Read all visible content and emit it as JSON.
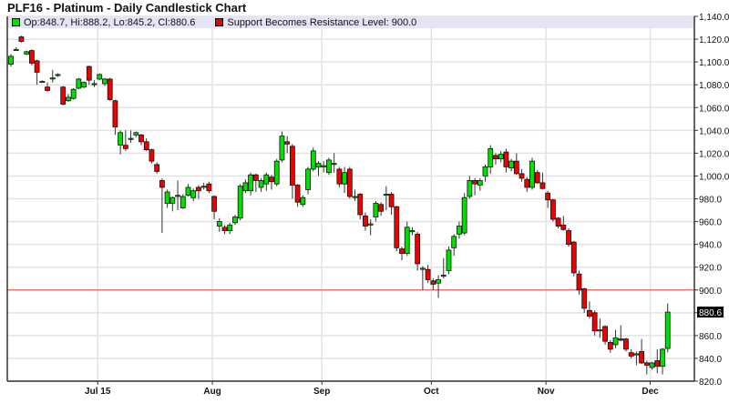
{
  "chart_data": {
    "type": "candlestick",
    "title": "PLF16 - Platinum - Daily Candlestick Chart",
    "legend": {
      "ohlc_label": "Op:848.7, Hi:888.2, Lo:845.2, Cl:880.6",
      "level_label": "Support Becomes Resistance Level: 900.0",
      "placement": "top-left"
    },
    "ylim": [
      820,
      1140
    ],
    "y_ticks": [
      "820.0",
      "840.0",
      "860.0",
      "880.0",
      "900.0",
      "920.0",
      "940.0",
      "960.0",
      "980.0",
      "1,000.0",
      "1,020.0",
      "1,040.0",
      "1,060.0",
      "1,080.0",
      "1,100.0",
      "1,120.0",
      "1,140.0"
    ],
    "y_tick_values": [
      820,
      840,
      860,
      880,
      900,
      920,
      940,
      960,
      980,
      1000,
      1020,
      1040,
      1060,
      1080,
      1100,
      1120,
      1140
    ],
    "x_ticks": [
      {
        "label": "Jul 15",
        "index": 17
      },
      {
        "label": "Aug",
        "index": 39
      },
      {
        "label": "Sep",
        "index": 60
      },
      {
        "label": "Oct",
        "index": 81
      },
      {
        "label": "Nov",
        "index": 103
      },
      {
        "label": "Dec",
        "index": 123
      }
    ],
    "last_price_label": "880.6",
    "last_price": 880.6,
    "resistance_level": 900.0,
    "grid": true,
    "colors": {
      "up": "#00e000",
      "down": "#ee0000",
      "level": "#f06060",
      "grid": "#e2e2e2"
    },
    "ohlc": [
      [
        1098,
        1107,
        1096,
        1105
      ],
      [
        1111,
        1113,
        1110,
        1111
      ],
      [
        1122,
        1123,
        1117,
        1118
      ],
      [
        1107,
        1110,
        1106,
        1109
      ],
      [
        1110,
        1111,
        1097,
        1099
      ],
      [
        1101,
        1102,
        1080,
        1091
      ],
      [
        1083,
        1084,
        1082,
        1083
      ],
      [
        1078,
        1082,
        1074,
        1075
      ],
      [
        1086,
        1093,
        1082,
        1086
      ],
      [
        1089,
        1090,
        1087,
        1089
      ],
      [
        1078,
        1079,
        1062,
        1063
      ],
      [
        1066,
        1072,
        1065,
        1069
      ],
      [
        1068,
        1077,
        1067,
        1076
      ],
      [
        1077,
        1086,
        1076,
        1085
      ],
      [
        1078,
        1083,
        1077,
        1082
      ],
      [
        1096,
        1097,
        1080,
        1084
      ],
      [
        1081,
        1084,
        1078,
        1081
      ],
      [
        1085,
        1090,
        1084,
        1089
      ],
      [
        1081,
        1086,
        1079,
        1085
      ],
      [
        1085,
        1086,
        1066,
        1067
      ],
      [
        1066,
        1067,
        1036,
        1043
      ],
      [
        1027,
        1040,
        1019,
        1038
      ],
      [
        1027,
        1040,
        1022,
        1024
      ],
      [
        1033,
        1040,
        1029,
        1033
      ],
      [
        1036,
        1039,
        1034,
        1038
      ],
      [
        1036,
        1037,
        1027,
        1030
      ],
      [
        1030,
        1033,
        1022,
        1023
      ],
      [
        1023,
        1024,
        1011,
        1013
      ],
      [
        1010,
        1012,
        1002,
        1004
      ],
      [
        996,
        998,
        950,
        990
      ],
      [
        976,
        988,
        972,
        986
      ],
      [
        976,
        982,
        969,
        981
      ],
      [
        983,
        996,
        970,
        983
      ],
      [
        972,
        984,
        971,
        982
      ],
      [
        983,
        993,
        982,
        990
      ],
      [
        981,
        989,
        978,
        987
      ],
      [
        990,
        992,
        980,
        987
      ],
      [
        991,
        994,
        988,
        991
      ],
      [
        993,
        995,
        985,
        987
      ],
      [
        982,
        983,
        962,
        969
      ],
      [
        956,
        963,
        951,
        960
      ],
      [
        955,
        957,
        949,
        952
      ],
      [
        952,
        959,
        949,
        957
      ],
      [
        959,
        966,
        957,
        964
      ],
      [
        963,
        993,
        961,
        991
      ],
      [
        987,
        997,
        985,
        994
      ],
      [
        987,
        1003,
        983,
        1001
      ],
      [
        1001,
        1002,
        986,
        996
      ],
      [
        990,
        998,
        986,
        996
      ],
      [
        993,
        1003,
        987,
        1001
      ],
      [
        999,
        1001,
        988,
        995
      ],
      [
        993,
        1015,
        991,
        1013
      ],
      [
        1014,
        1039,
        1012,
        1035
      ],
      [
        1030,
        1035,
        1020,
        1028
      ],
      [
        1026,
        1028,
        980,
        992
      ],
      [
        992,
        993,
        973,
        977
      ],
      [
        975,
        983,
        973,
        981
      ],
      [
        988,
        1008,
        984,
        1006
      ],
      [
        1006,
        1025,
        1004,
        1022
      ],
      [
        1008,
        1013,
        1000,
        1011
      ],
      [
        1009,
        1013,
        1003,
        1009
      ],
      [
        1003,
        1016,
        1001,
        1014
      ],
      [
        1011,
        1020,
        1003,
        1011
      ],
      [
        1006,
        1008,
        990,
        993
      ],
      [
        993,
        1008,
        985,
        1003
      ],
      [
        1006,
        1008,
        980,
        982
      ],
      [
        982,
        988,
        978,
        982
      ],
      [
        984,
        985,
        962,
        966
      ],
      [
        965,
        968,
        952,
        956
      ],
      [
        957,
        962,
        948,
        958
      ],
      [
        964,
        978,
        960,
        976
      ],
      [
        975,
        977,
        965,
        969
      ],
      [
        984,
        991,
        970,
        984
      ],
      [
        984,
        986,
        966,
        973
      ],
      [
        973,
        974,
        934,
        937
      ],
      [
        936,
        938,
        926,
        932
      ],
      [
        932,
        960,
        930,
        955
      ],
      [
        952,
        955,
        948,
        952
      ],
      [
        949,
        951,
        917,
        923
      ],
      [
        919,
        921,
        900,
        919
      ],
      [
        918,
        922,
        906,
        909
      ],
      [
        908,
        910,
        900,
        905
      ],
      [
        906,
        913,
        893,
        909
      ],
      [
        912,
        928,
        910,
        913
      ],
      [
        917,
        938,
        914,
        935
      ],
      [
        937,
        949,
        930,
        947
      ],
      [
        949,
        960,
        945,
        956
      ],
      [
        950,
        985,
        948,
        981
      ],
      [
        982,
        1000,
        980,
        996
      ],
      [
        996,
        998,
        983,
        993
      ],
      [
        992,
        998,
        987,
        996
      ],
      [
        1000,
        1010,
        995,
        1008
      ],
      [
        1008,
        1027,
        1002,
        1024
      ],
      [
        1018,
        1020,
        1010,
        1015
      ],
      [
        1015,
        1022,
        1012,
        1019
      ],
      [
        1021,
        1024,
        1003,
        1008
      ],
      [
        1007,
        1015,
        1004,
        1013
      ],
      [
        1013,
        1020,
        1001,
        1002
      ],
      [
        1002,
        1006,
        995,
        998
      ],
      [
        997,
        999,
        986,
        990
      ],
      [
        990,
        1016,
        988,
        1013
      ],
      [
        1003,
        1005,
        993,
        994
      ],
      [
        994,
        1003,
        988,
        989
      ],
      [
        985,
        987,
        972,
        979
      ],
      [
        979,
        980,
        960,
        962
      ],
      [
        963,
        964,
        954,
        956
      ],
      [
        957,
        965,
        952,
        953
      ],
      [
        952,
        954,
        938,
        940
      ],
      [
        942,
        943,
        912,
        915
      ],
      [
        914,
        917,
        896,
        900
      ],
      [
        901,
        902,
        880,
        884
      ],
      [
        882,
        890,
        875,
        877
      ],
      [
        880,
        882,
        860,
        864
      ],
      [
        865,
        875,
        858,
        865
      ],
      [
        868,
        869,
        852,
        855
      ],
      [
        854,
        856,
        845,
        848
      ],
      [
        852,
        865,
        849,
        858
      ],
      [
        857,
        869,
        855,
        856
      ],
      [
        857,
        858,
        846,
        848
      ],
      [
        845,
        848,
        840,
        842
      ],
      [
        844,
        846,
        834,
        844
      ],
      [
        846,
        857,
        835,
        836
      ],
      [
        836,
        838,
        826,
        834
      ],
      [
        832,
        837,
        830,
        836
      ],
      [
        838,
        848,
        827,
        833
      ],
      [
        833,
        849,
        826,
        848
      ],
      [
        848.7,
        888.2,
        845.2,
        880.6
      ]
    ]
  }
}
